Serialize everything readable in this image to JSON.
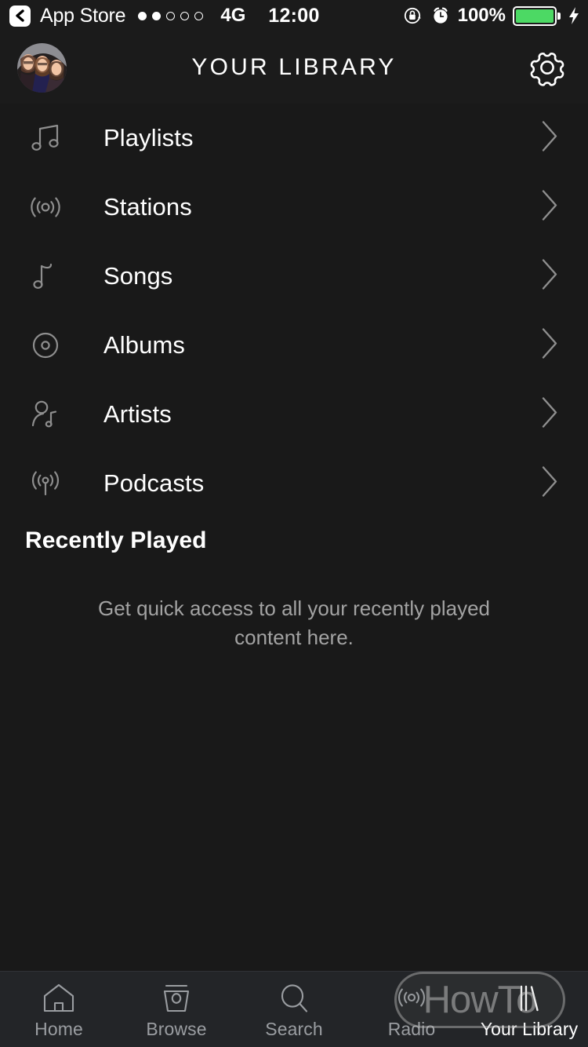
{
  "statusbar": {
    "back_label": "App Store",
    "back_icon": "chevron-left-icon",
    "signal_dots_filled": 2,
    "signal_dots_total": 5,
    "network": "4G",
    "time": "12:00",
    "rotation_lock_icon": "rotation-lock-icon",
    "alarm_icon": "alarm-clock-icon",
    "battery_percent": "100%",
    "battery_level": 100,
    "battery_color": "#4cd964",
    "charging_icon": "lightning-bolt-icon"
  },
  "header": {
    "avatar_name": "user-avatar",
    "title": "YOUR LIBRARY",
    "settings_icon": "gear-icon"
  },
  "library": {
    "items": [
      {
        "label": "Playlists",
        "icon": "double-music-note-icon"
      },
      {
        "label": "Stations",
        "icon": "radio-waves-icon"
      },
      {
        "label": "Songs",
        "icon": "single-music-note-icon"
      },
      {
        "label": "Albums",
        "icon": "disc-icon"
      },
      {
        "label": "Artists",
        "icon": "artist-person-note-icon"
      },
      {
        "label": "Podcasts",
        "icon": "podcast-broadcast-icon"
      }
    ],
    "chevron_icon": "chevron-right-icon"
  },
  "recently_played": {
    "title": "Recently Played",
    "empty_message": "Get quick access to all your recently played content here."
  },
  "bottom_nav": {
    "items": [
      {
        "label": "Home",
        "icon": "home-icon",
        "active": false
      },
      {
        "label": "Browse",
        "icon": "browse-icon",
        "active": false
      },
      {
        "label": "Search",
        "icon": "search-icon",
        "active": false
      },
      {
        "label": "Radio",
        "icon": "radio-icon",
        "active": false
      },
      {
        "label": "Your Library",
        "icon": "library-icon",
        "active": true
      }
    ]
  },
  "watermark": {
    "text": "HowTo"
  },
  "colors": {
    "background": "#191919",
    "header_bg": "#1b1b1b",
    "navbar_bg": "#232528",
    "text_primary": "#ffffff",
    "text_secondary": "#a3a3a3",
    "icon_gray": "#8e8e8e",
    "battery_green": "#4cd964"
  }
}
